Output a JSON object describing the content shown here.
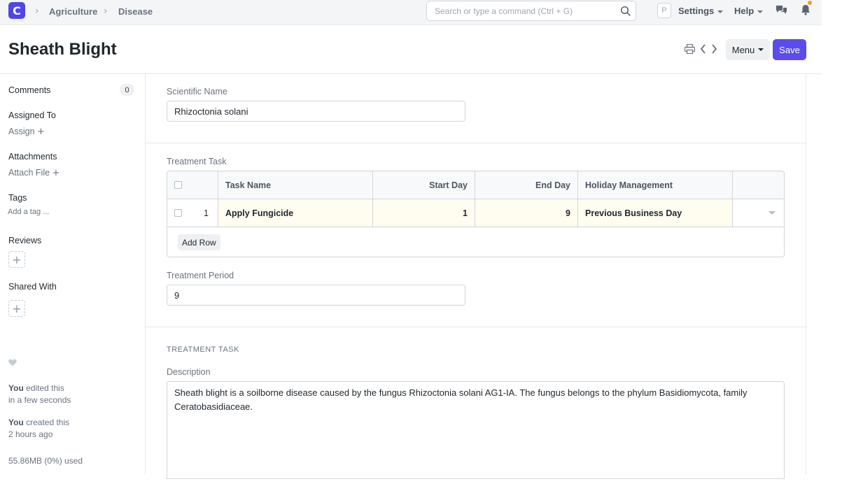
{
  "navbar": {
    "logo_letter": "C",
    "breadcrumbs": [
      "Agriculture",
      "Disease"
    ],
    "search_placeholder": "Search or type a command (Ctrl + G)",
    "avatar_letter": "P",
    "settings_label": "Settings",
    "help_label": "Help"
  },
  "page": {
    "title": "Sheath Blight",
    "menu_label": "Menu",
    "save_label": "Save"
  },
  "sidebar": {
    "comments_label": "Comments",
    "comments_count": "0",
    "assigned_to_label": "Assigned To",
    "assign_link": "Assign",
    "attachments_label": "Attachments",
    "attach_link": "Attach File",
    "tags_label": "Tags",
    "add_tag_link": "Add a tag ...",
    "reviews_label": "Reviews",
    "shared_with_label": "Shared With",
    "activity": [
      {
        "who": "You",
        "what": " edited this",
        "when": "in a few seconds"
      },
      {
        "who": "You",
        "what": " created this",
        "when": "2 hours ago"
      }
    ],
    "storage_used": "55.86MB (0%) used"
  },
  "form": {
    "scientific_name_label": "Scientific Name",
    "scientific_name_value": "Rhizoctonia solani",
    "treatment_task_label": "Treatment Task",
    "table": {
      "columns": [
        "Task Name",
        "Start Day",
        "End Day",
        "Holiday Management"
      ],
      "rows": [
        {
          "idx": "1",
          "task_name": "Apply Fungicide",
          "start_day": "1",
          "end_day": "9",
          "holiday_management": "Previous Business Day"
        }
      ],
      "add_row_label": "Add Row"
    },
    "treatment_period_label": "Treatment Period",
    "treatment_period_value": "9",
    "section_heading": "TREATMENT TASK",
    "description_label": "Description",
    "description_value": "Sheath blight is a soilborne disease caused by the fungus Rhizoctonia solani AG1-IA. The fungus belongs to the phylum Basidiomycota, family Ceratobasidiaceae."
  },
  "colors": {
    "primary": "#5c4ced",
    "logo": "#4f46e5",
    "notification_dot": "#f59e0b",
    "row_highlight": "#fffdf0"
  }
}
